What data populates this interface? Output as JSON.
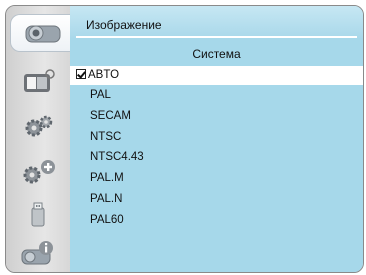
{
  "header": {
    "title": "Изображение"
  },
  "submenu": {
    "title": "Система"
  },
  "options": [
    {
      "label": "ABTO",
      "checked": true
    },
    {
      "label": "PAL"
    },
    {
      "label": "SECAM"
    },
    {
      "label": "NTSC"
    },
    {
      "label": "NTSC4.43"
    },
    {
      "label": "PAL.M"
    },
    {
      "label": "PAL.N"
    },
    {
      "label": "PAL60"
    }
  ],
  "sidebar": {
    "icons": [
      "projector-icon",
      "image-adjust-icon",
      "gear-icon",
      "gear-plus-icon",
      "usb-drive-icon",
      "projector-info-icon"
    ],
    "active": "projector-icon"
  },
  "colors": {
    "panel": "#a6d8ea",
    "selected_row": "#ffffff",
    "sidebar": "#dcdcdc"
  }
}
